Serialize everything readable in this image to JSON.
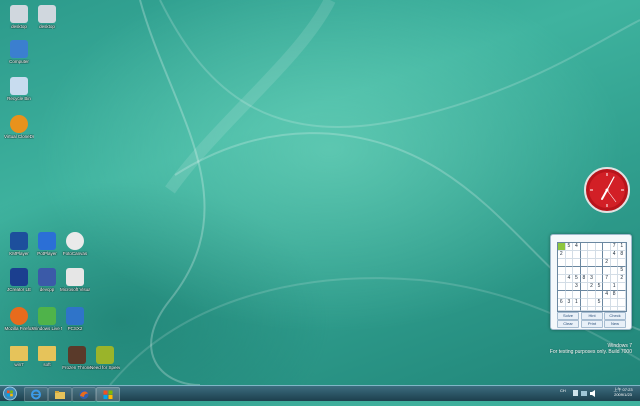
{
  "desktop": {
    "icons": [
      {
        "name": "desktop-icon-1",
        "label": "desktop",
        "glyph": "file-icon",
        "color": "#d0d7de"
      },
      {
        "name": "desktop-icon-2",
        "label": "desktop",
        "glyph": "file-icon",
        "color": "#d0d7de"
      },
      {
        "name": "computer",
        "label": "Computer",
        "glyph": "computer-icon",
        "color": "#3b7fcf"
      },
      {
        "name": "recycle-bin",
        "label": "Recycle Bin",
        "glyph": "recycle-bin-icon",
        "color": "#c8dcef"
      },
      {
        "name": "virtual-clone-drive",
        "label": "Virtual CloneDrive",
        "glyph": "clone-drive-icon",
        "color": "#e8921c"
      },
      {
        "name": "kmplayer",
        "label": "KMPlayer",
        "glyph": "kmplayer-icon",
        "color": "#1d4f9c"
      },
      {
        "name": "potplayer",
        "label": "PotPlayer",
        "glyph": "potplayer-icon",
        "color": "#2b6fd6"
      },
      {
        "name": "fotocanvas",
        "label": "FotoCanvas",
        "glyph": "fotocanvas-icon",
        "color": "#eaeaea"
      },
      {
        "name": "jcreator",
        "label": "JCreator LE",
        "glyph": "jcreator-icon",
        "color": "#1b3f8f"
      },
      {
        "name": "devcpp",
        "label": "devcpp",
        "glyph": "devcpp-icon",
        "color": "#3b5aa8"
      },
      {
        "name": "visual-cpp",
        "label": "Microsoft Visual C++...",
        "glyph": "visual-cpp-icon",
        "color": "#e6e6e6"
      },
      {
        "name": "firefox",
        "label": "Mozilla Firefox",
        "glyph": "firefox-icon",
        "color": "#e76b1d"
      },
      {
        "name": "windows-live-messenger",
        "label": "Windows Live Mess...",
        "glyph": "messenger-icon",
        "color": "#4fb34a"
      },
      {
        "name": "pcsx2",
        "label": "PCSX2",
        "glyph": "pcsx2-icon",
        "color": "#2f74c9"
      },
      {
        "name": "win7",
        "label": "win7",
        "glyph": "folder-icon",
        "color": "#e6c35a"
      },
      {
        "name": "soft",
        "label": "soft",
        "glyph": "folder-icon",
        "color": "#e6c35a"
      },
      {
        "name": "frozen-throne",
        "label": "Frozen Throne",
        "glyph": "frozen-throne-icon",
        "color": "#5a3a2a"
      },
      {
        "name": "need-for-speed",
        "label": "Need for Speed ...",
        "glyph": "need-for-speed-icon",
        "color": "#9ab42a"
      }
    ]
  },
  "clock": {
    "accent": "#d21f26"
  },
  "sudoku": {
    "grid": [
      [
        "",
        "5",
        "4",
        "",
        "",
        "",
        "",
        "7",
        "1"
      ],
      [
        "2",
        "",
        "",
        "",
        "",
        "",
        "",
        "4",
        "8"
      ],
      [
        "",
        "",
        "",
        "",
        "",
        "",
        "2",
        "",
        ""
      ],
      [
        "",
        "",
        "",
        "",
        "",
        "",
        "",
        "",
        "5"
      ],
      [
        "",
        "4",
        "5",
        "8",
        "3",
        "",
        "7",
        "",
        "2"
      ],
      [
        "",
        "",
        "3",
        "",
        "2",
        "5",
        "",
        "1",
        ""
      ],
      [
        "",
        "",
        "",
        "",
        "",
        "",
        "4",
        "8",
        ""
      ],
      [
        "6",
        "3",
        "1",
        "",
        "",
        "5",
        "",
        "",
        ""
      ],
      [
        "",
        "",
        "",
        "",
        "",
        "",
        "",
        "",
        ""
      ]
    ],
    "buttons": {
      "solve": "Solve",
      "hint": "Hint",
      "check": "Check",
      "clear": "Clear",
      "print": "Print",
      "new": "New"
    }
  },
  "watermark": {
    "line1": "Windows 7",
    "line2": "For testing purposes only. Build 7000"
  },
  "taskbar": {
    "tray_lang": "CH",
    "time": "上午 07:23",
    "date": "2009/1/23"
  }
}
